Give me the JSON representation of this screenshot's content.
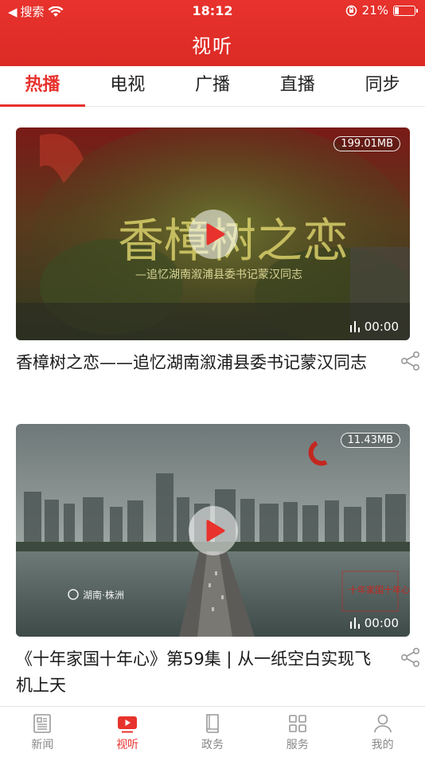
{
  "status_bar": {
    "back_app": "搜索",
    "time": "18:12",
    "battery": "21%",
    "battery_level": 0.21
  },
  "page_title": "视听",
  "tabs": [
    {
      "label": "热播",
      "active": true
    },
    {
      "label": "电视",
      "active": false
    },
    {
      "label": "广播",
      "active": false
    },
    {
      "label": "直播",
      "active": false
    },
    {
      "label": "同步",
      "active": false
    }
  ],
  "videos": [
    {
      "title": "香樟树之恋——追忆湖南溆浦县委书记蒙汉同志",
      "size": "199.01MB",
      "duration": "00:00",
      "overlay_title": "香樟树之恋",
      "overlay_subtitle": "—追忆湖南溆浦县委书记蒙汉同志"
    },
    {
      "title": "《十年家国十年心》第59集 | 从一纸空白实现飞机上天",
      "size": "11.43MB",
      "duration": "00:00",
      "location_tag": "湖南·株洲",
      "series_tag": "十年家国十年心"
    }
  ],
  "bottom_nav": [
    {
      "label": "新闻",
      "icon": "newspaper-icon",
      "active": false
    },
    {
      "label": "视听",
      "icon": "video-play-icon",
      "active": true
    },
    {
      "label": "政务",
      "icon": "government-book-icon",
      "active": false
    },
    {
      "label": "服务",
      "icon": "grid-icon",
      "active": false
    },
    {
      "label": "我的",
      "icon": "user-icon",
      "active": false
    }
  ],
  "colors": {
    "brand_red": "#e8322d",
    "inactive_gray": "#888888"
  }
}
